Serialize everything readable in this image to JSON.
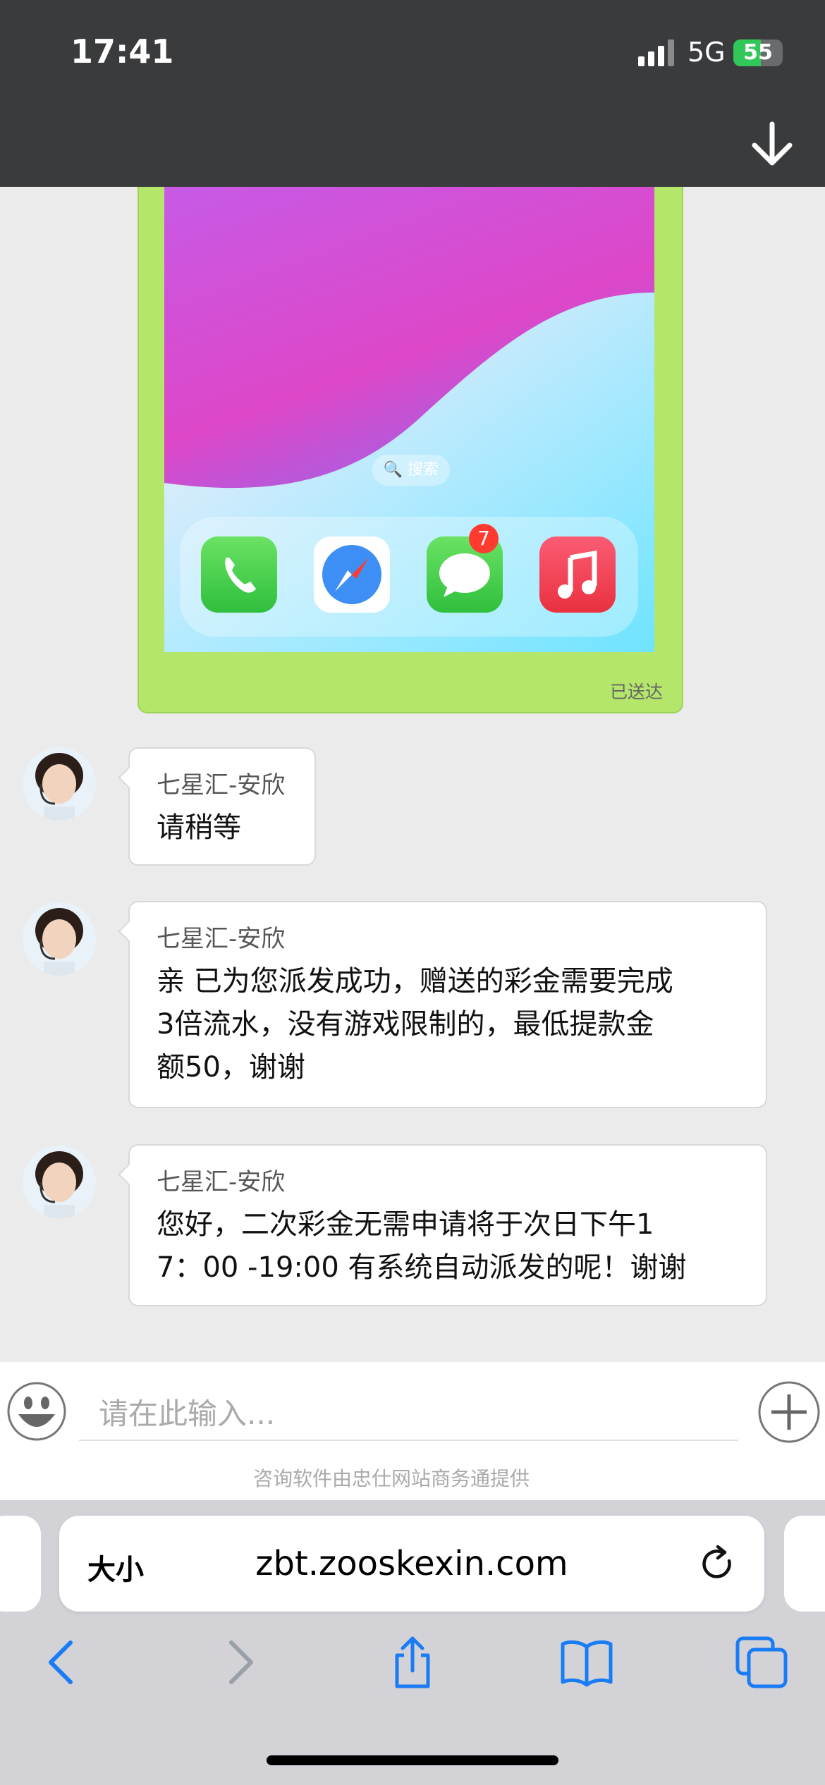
{
  "status_bar": {
    "time": "17:41",
    "network": "5G",
    "battery": "55",
    "battery_level_pct": 55
  },
  "sent_message": {
    "search_pill": "🔍 搜索",
    "messages_badge": "7",
    "status": "已送达"
  },
  "messages": [
    {
      "sender": "七星汇-安欣",
      "lines": [
        "请稍等"
      ]
    },
    {
      "sender": "七星汇-安欣",
      "lines": [
        "亲 已为您派发成功，赠送的彩金需要完成",
        "3倍流水，没有游戏限制的，最低提款金",
        "额50，谢谢"
      ]
    },
    {
      "sender": "七星汇-安欣",
      "lines": [
        "您好，二次彩金无需申请将于次日下午1",
        "7：00 -19:00 有系统自动派发的呢！谢谢"
      ]
    }
  ],
  "input": {
    "placeholder": "请在此输入...",
    "powered_by": "咨询软件由忠仕网站商务通提供"
  },
  "browser": {
    "text_size_label": "大小",
    "url": "zbt.zooskexin.com"
  },
  "icons": [
    "signal-icon",
    "battery-icon",
    "down-arrow-icon",
    "phone-app-icon",
    "safari-app-icon",
    "messages-app-icon",
    "music-app-icon",
    "smiley-icon",
    "plus-icon",
    "reload-icon",
    "back-icon",
    "forward-icon",
    "share-icon",
    "bookmarks-icon",
    "tabs-icon"
  ]
}
